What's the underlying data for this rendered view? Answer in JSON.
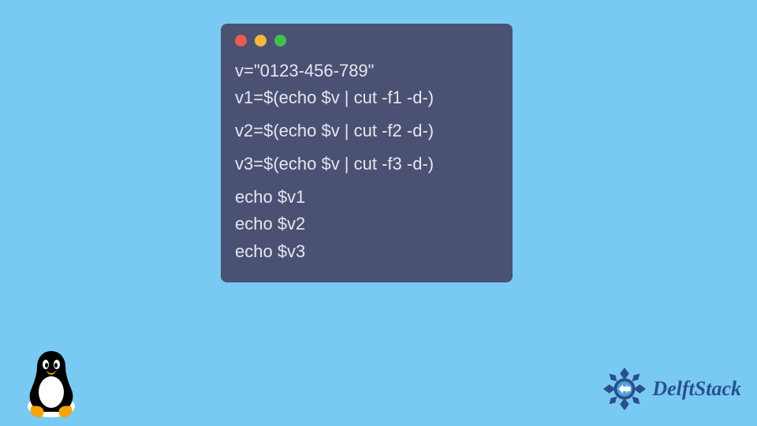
{
  "dots": [
    "#ee5b4f",
    "#f7b835",
    "#3fc24a"
  ],
  "code": {
    "l1": "v=\"0123-456-789\"",
    "l2": "v1=$(echo $v | cut -f1 -d-)",
    "l3": "v2=$(echo $v | cut -f2 -d-)",
    "l4": "v3=$(echo $v | cut -f3 -d-)",
    "l5": "echo $v1",
    "l6": "echo $v2",
    "l7": "echo $v3"
  },
  "brand": "DelftStack"
}
